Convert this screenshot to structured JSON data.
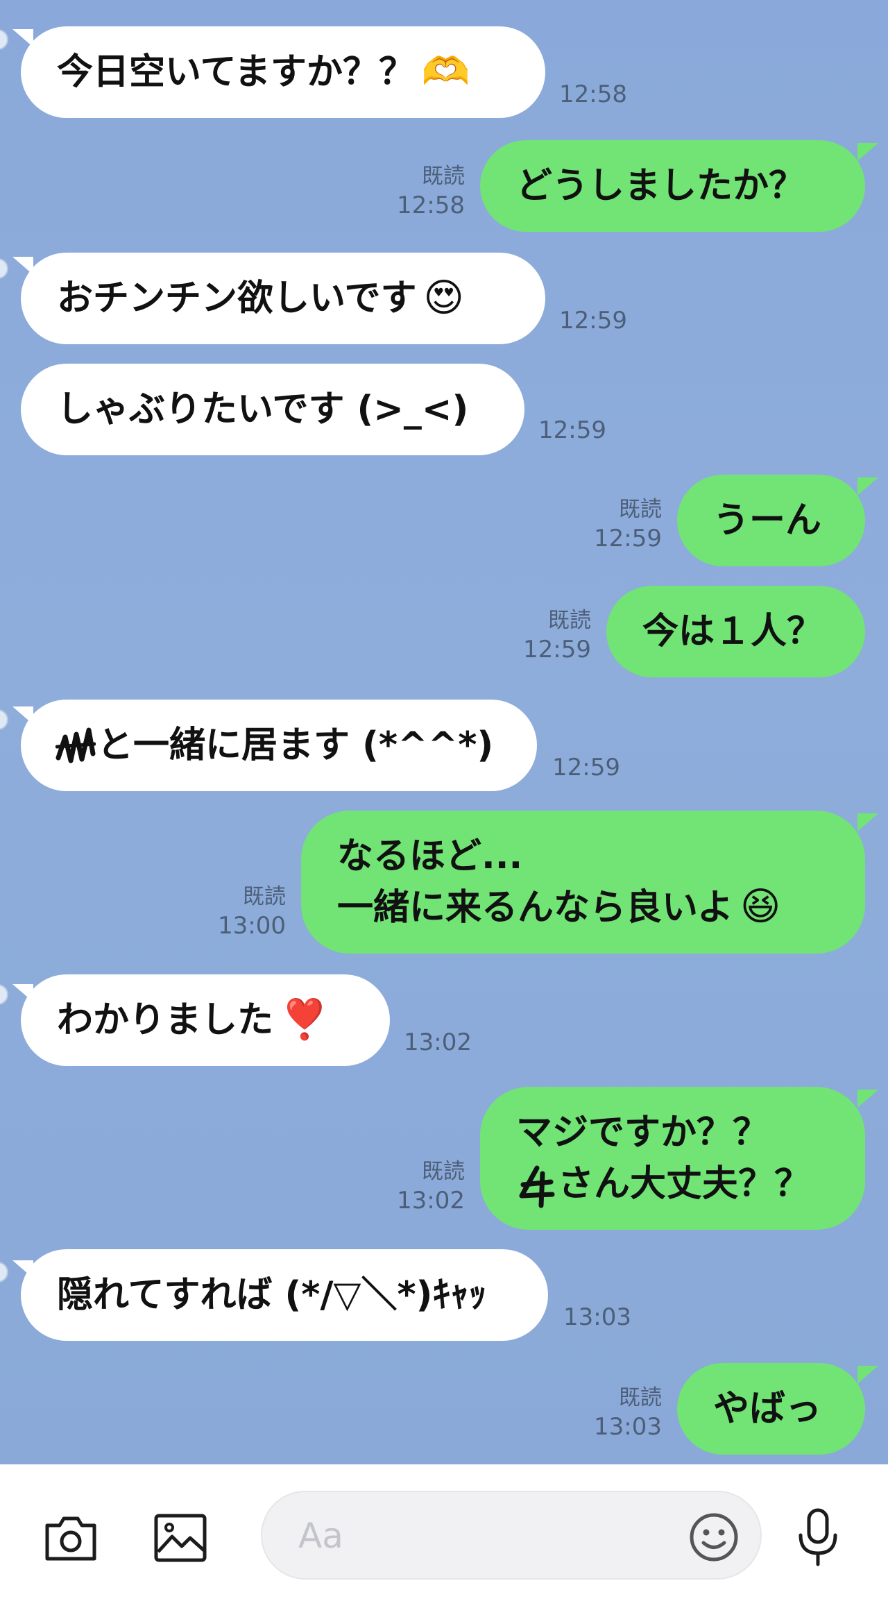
{
  "messages": [
    {
      "id": 1,
      "side": "in",
      "text": "今日空いてますか？？",
      "emoji": "🫶",
      "time": "12:58"
    },
    {
      "id": 2,
      "side": "out",
      "text": "どうしましたか？",
      "read": "既読",
      "time": "12:58"
    },
    {
      "id": 3,
      "side": "in",
      "text": "おチンチン欲しいです",
      "emoji": "😍",
      "time": "12:59"
    },
    {
      "id": 4,
      "side": "in",
      "text": "しゃぶりたいです (>_<)",
      "time": "12:59"
    },
    {
      "id": 5,
      "side": "out",
      "text": "うーん",
      "read": "既読",
      "time": "12:59"
    },
    {
      "id": 6,
      "side": "out",
      "text": "今は１人？",
      "read": "既読",
      "time": "12:59"
    },
    {
      "id": 7,
      "side": "in",
      "text": "と一緒に居ます (*^^*)",
      "time": "12:59"
    },
    {
      "id": 8,
      "side": "out",
      "lines": [
        "なるほど...",
        "一緒に来るんなら良いよ"
      ],
      "emoji": "😆",
      "read": "既読",
      "time": "13:00"
    },
    {
      "id": 9,
      "side": "in",
      "text": "わかりました",
      "emoji": "❣️",
      "time": "13:02"
    },
    {
      "id": 10,
      "side": "out",
      "lines": [
        "マジですか？？",
        "さん大丈夫？？"
      ],
      "read": "既読",
      "time": "13:02"
    },
    {
      "id": 11,
      "side": "in",
      "text": "隠れてすれば (*/▽＼*)ｷｬｯ",
      "time": "13:03"
    },
    {
      "id": 12,
      "side": "out",
      "text": "やばっ",
      "read": "既読",
      "time": "13:03"
    }
  ],
  "toolbar": {
    "camera_icon": "camera-icon",
    "image_icon": "image-icon",
    "input_placeholder": "Aa",
    "emoji_icon": "smiley-icon",
    "mic_icon": "microphone-icon"
  },
  "colors": {
    "chat_background": "#8cabd9",
    "incoming_bubble": "#ffffff",
    "outgoing_bubble": "#71e475",
    "meta_text": "#4d5f78"
  }
}
